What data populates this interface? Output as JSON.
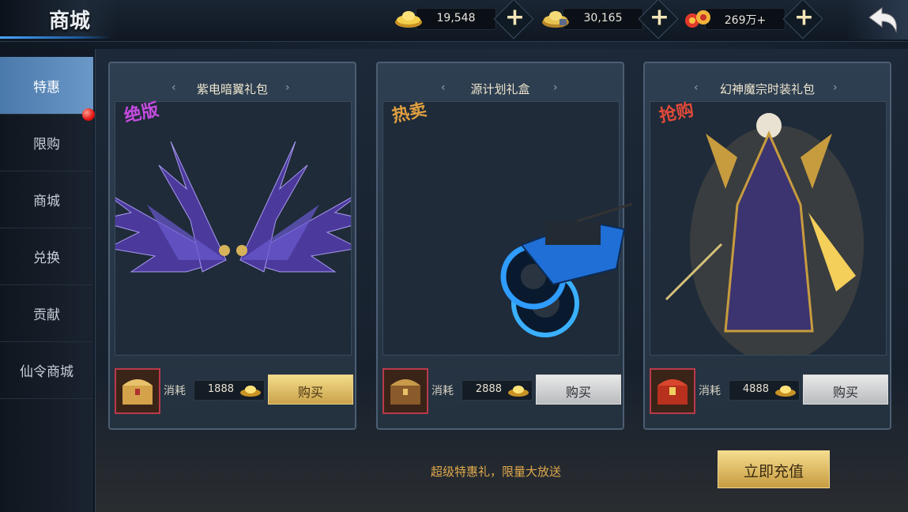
{
  "header": {
    "title": "商城",
    "currencies": [
      {
        "icon": "gold-ingot-icon",
        "value": "19,548"
      },
      {
        "icon": "bound-gold-ingot-icon",
        "value": "30,165"
      },
      {
        "icon": "coin-string-icon",
        "value": "269万+"
      }
    ]
  },
  "sidebar": {
    "items": [
      {
        "label": "特惠"
      },
      {
        "label": "限购"
      },
      {
        "label": "商城"
      },
      {
        "label": "兑换"
      },
      {
        "label": "贡献"
      },
      {
        "label": "仙令商城"
      }
    ],
    "active_index": 0
  },
  "cards": [
    {
      "name": "紫电暗翼礼包",
      "tag": "绝版",
      "tag_color": "#c44be0",
      "cost_label": "消耗",
      "cost": "1888",
      "buy_label": "购买",
      "button_style": "gold",
      "image": "purple-wings"
    },
    {
      "name": "源计划礼盒",
      "tag": "热卖",
      "tag_color": "#e0a040",
      "cost_label": "消耗",
      "cost": "2888",
      "buy_label": "购买",
      "button_style": "gray",
      "image": "blue-motorcycle"
    },
    {
      "name": "幻神魔宗时装礼包",
      "tag": "抢购",
      "tag_color": "#e04a3a",
      "cost_label": "消耗",
      "cost": "4888",
      "buy_label": "购买",
      "button_style": "gray",
      "image": "golden-warrior"
    }
  ],
  "footer": {
    "slogan": "超级特惠礼，限量大放送",
    "recharge_label": "立即充值"
  },
  "colors": {
    "accent_blue": "#4a79ab",
    "gold_button": "#f3dc8a",
    "slogan": "#e1a94e"
  }
}
